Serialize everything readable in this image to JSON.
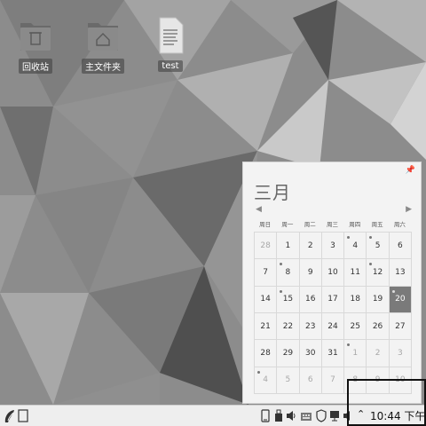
{
  "desktop": {
    "icons": [
      {
        "label": "回收站",
        "icon": "trash-folder-icon"
      },
      {
        "label": "主文件夹",
        "icon": "home-folder-icon"
      },
      {
        "label": "test",
        "icon": "text-file-icon"
      }
    ]
  },
  "calendar": {
    "month_title": "三月",
    "weekdays": [
      "周日",
      "周一",
      "周二",
      "周三",
      "周四",
      "周五",
      "周六"
    ],
    "weeks": [
      [
        "28",
        "1",
        "2",
        "3",
        "4",
        "5",
        "6"
      ],
      [
        "7",
        "8",
        "9",
        "10",
        "11",
        "12",
        "13"
      ],
      [
        "14",
        "15",
        "16",
        "17",
        "18",
        "19",
        "20"
      ],
      [
        "21",
        "22",
        "23",
        "24",
        "25",
        "26",
        "27"
      ],
      [
        "28",
        "29",
        "30",
        "31",
        "1",
        "2",
        "3"
      ],
      [
        "4",
        "5",
        "6",
        "7",
        "8",
        "9",
        "10"
      ]
    ]
  },
  "taskbar": {
    "clock": "10:44 下午",
    "tray_icons": [
      "tablet-icon",
      "usb-drive-icon",
      "volume-icon",
      "keyboard-icon",
      "shield-icon",
      "monitor-network-icon",
      "speaker-icon"
    ]
  }
}
